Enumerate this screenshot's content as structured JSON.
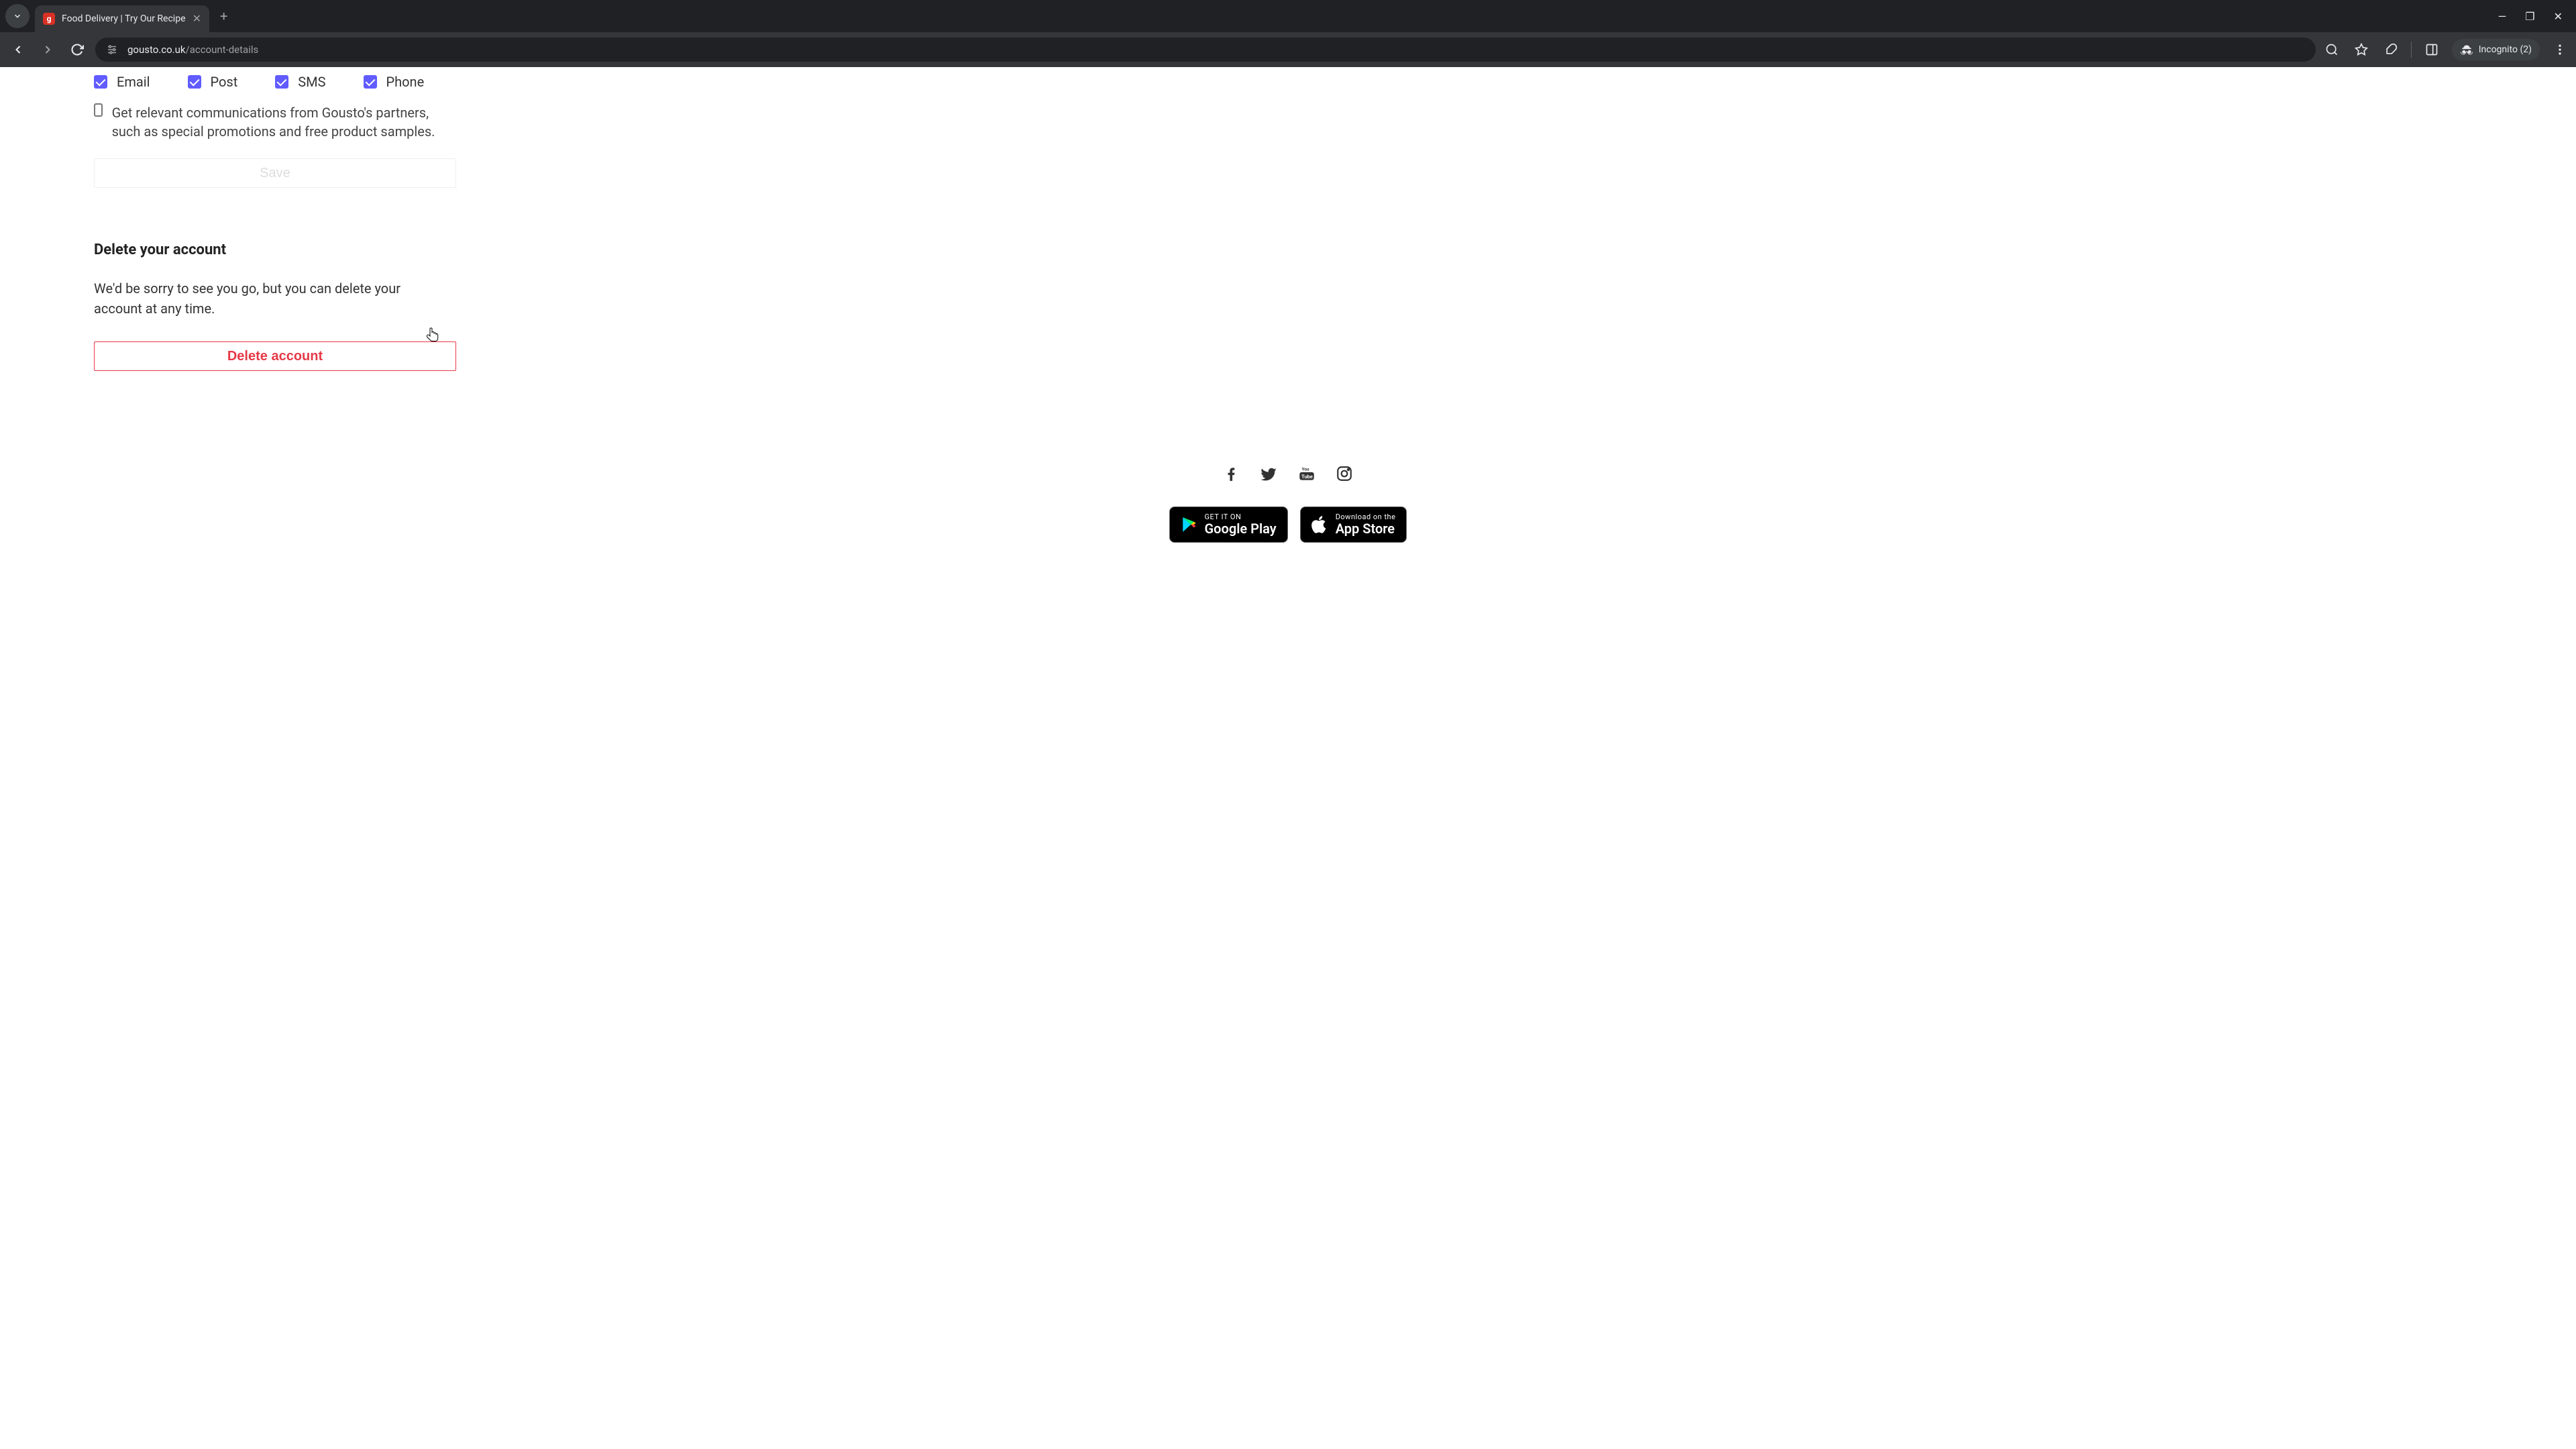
{
  "browser": {
    "tab_title": "Food Delivery | Try Our Recipe",
    "url_host": "gousto.co.uk",
    "url_path": "/account-details",
    "incognito_label": "Incognito (2)"
  },
  "prefs": {
    "channels": [
      {
        "label": "Email",
        "checked": true
      },
      {
        "label": "Post",
        "checked": true
      },
      {
        "label": "SMS",
        "checked": true
      },
      {
        "label": "Phone",
        "checked": true
      }
    ],
    "partner_text": "Get relevant communications from Gousto's partners, such as special promotions and free product samples.",
    "partner_checked": false,
    "save_label": "Save"
  },
  "delete_section": {
    "heading": "Delete your account",
    "body": "We'd be sorry to see you go, but you can delete your account at any time.",
    "button_label": "Delete account"
  },
  "footer": {
    "google_play_small": "GET IT ON",
    "google_play_big": "Google Play",
    "app_store_small": "Download on the",
    "app_store_big": "App Store"
  }
}
